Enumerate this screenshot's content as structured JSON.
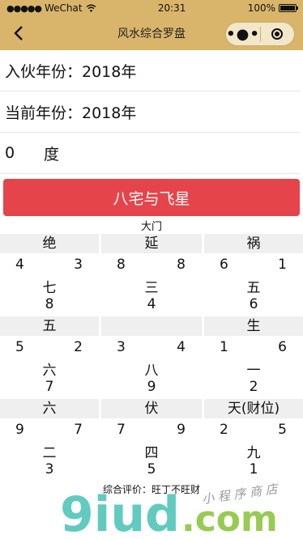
{
  "status": {
    "signal_dots": "●●●●●",
    "carrier": "WeChat",
    "time": "20:31",
    "battery": "100%"
  },
  "nav": {
    "title": "风水综合罗盘",
    "menu_glyph": "•●•"
  },
  "fields": {
    "move_in": "入伙年份：2018年",
    "current": "当前年份：2018年",
    "degree_value": "0",
    "degree_unit": "度"
  },
  "button": {
    "label": "八宅与飞星"
  },
  "door_label": "大门",
  "grid": [
    {
      "head": "绝",
      "tl": "4",
      "tr": "3",
      "mid": "七",
      "bot": "8"
    },
    {
      "head": "延",
      "tl": "8",
      "tr": "8",
      "mid": "三",
      "bot": "4"
    },
    {
      "head": "祸",
      "tl": "6",
      "tr": "1",
      "mid": "五",
      "bot": "6"
    },
    {
      "head": "五",
      "tl": "5",
      "tr": "2",
      "mid": "六",
      "bot": "7"
    },
    {
      "head": "",
      "tl": "3",
      "tr": "4",
      "mid": "八",
      "bot": "9"
    },
    {
      "head": "生",
      "tl": "1",
      "tr": "6",
      "mid": "一",
      "bot": "2"
    },
    {
      "head": "六",
      "tl": "9",
      "tr": "7",
      "mid": "二",
      "bot": "3"
    },
    {
      "head": "伏",
      "tl": "7",
      "tr": "9",
      "mid": "四",
      "bot": "5"
    },
    {
      "head": "天(财位)",
      "tl": "2",
      "tr": "5",
      "mid": "九",
      "bot": "1"
    }
  ],
  "rating": "综合评价：旺丁不旺财",
  "watermark": {
    "text": "9iud.com",
    "tagline": "小 程 序 商 店"
  },
  "colors": {
    "header": "#d9b56b",
    "button": "#e5454a",
    "cell_head": "#efefef",
    "watermark": "#4fc6b8"
  }
}
